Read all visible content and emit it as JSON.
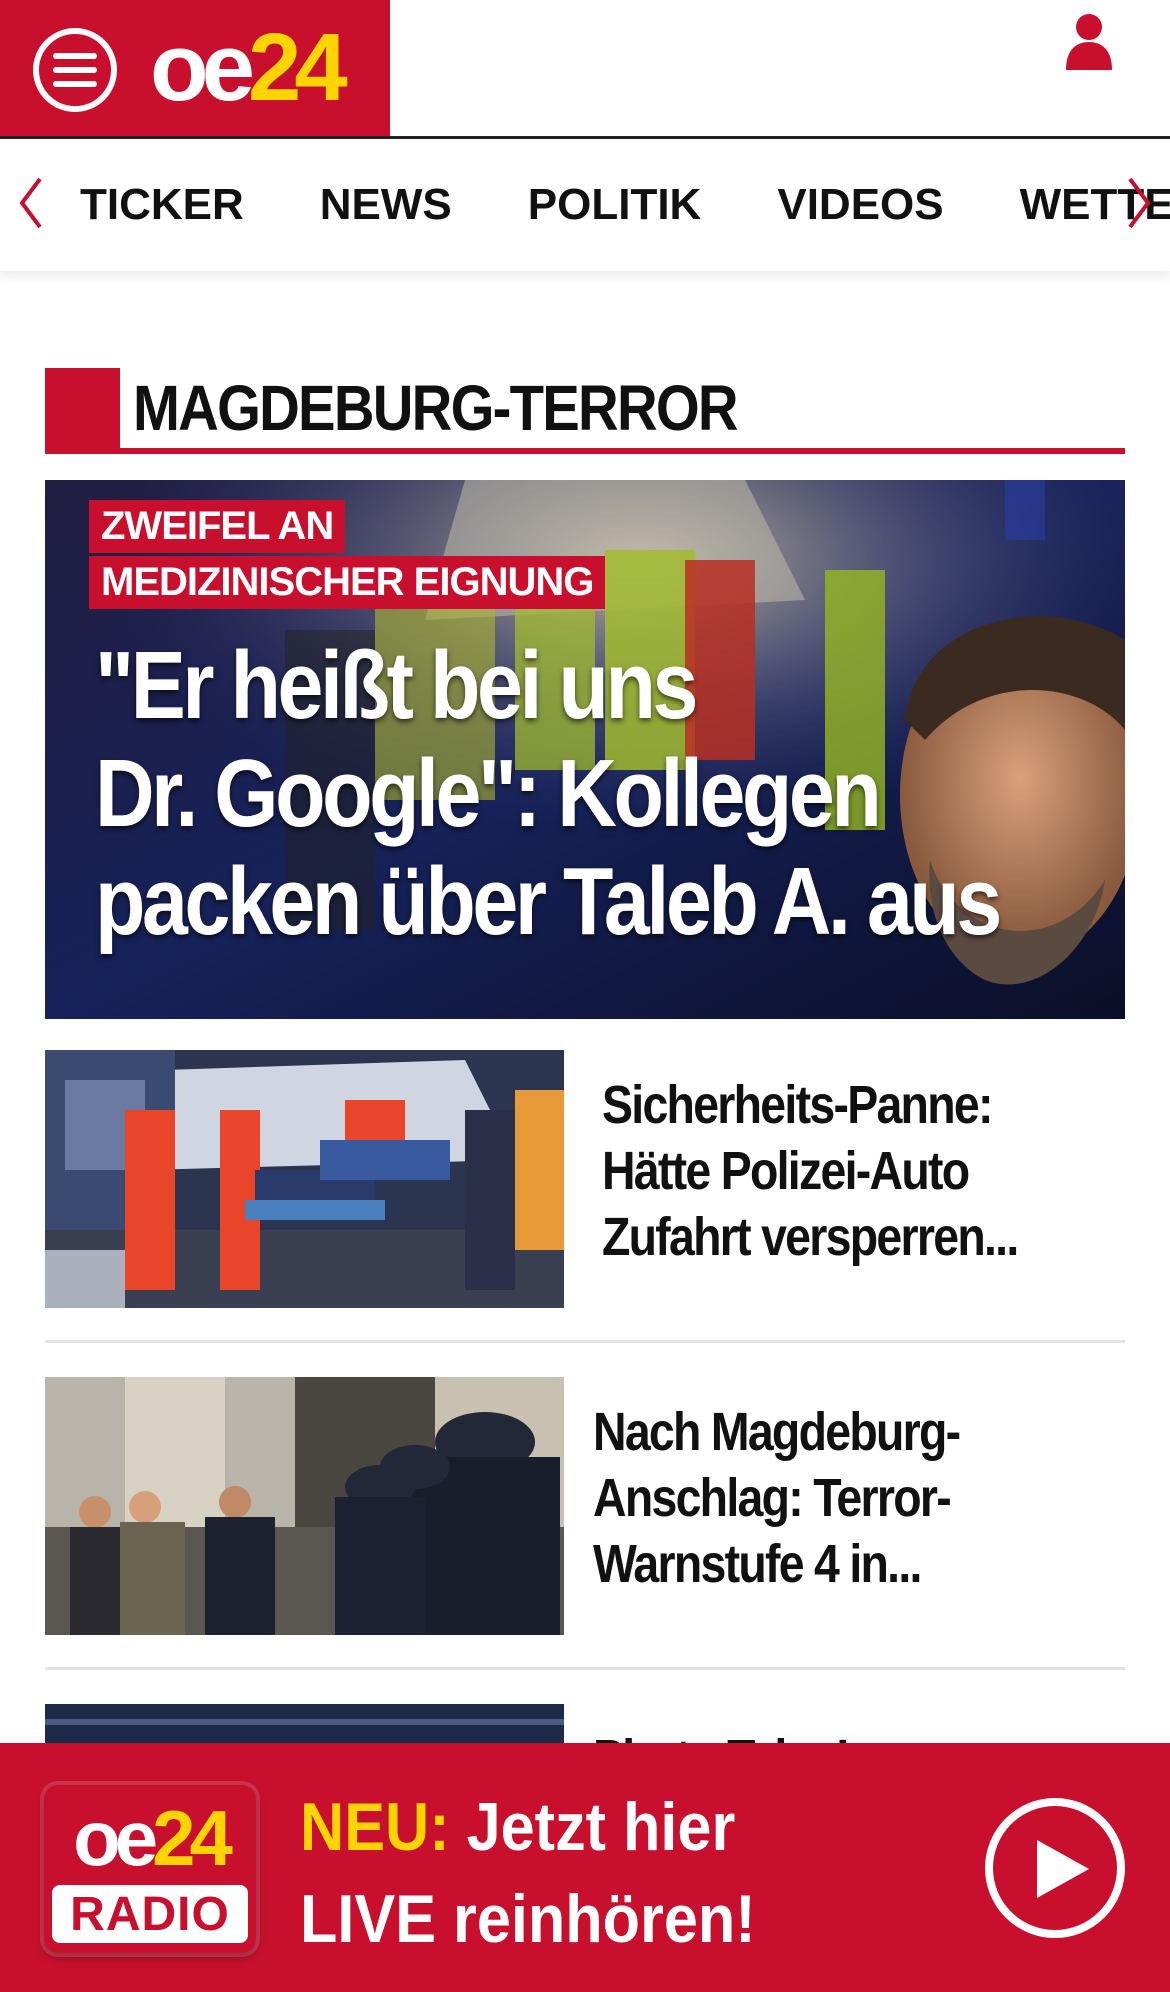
{
  "header": {
    "logo_oe": "oe",
    "logo_num": "24",
    "colors": {
      "brand": "#c8102e",
      "accent": "#ffd400"
    }
  },
  "nav": {
    "items": [
      "TICKER",
      "NEWS",
      "POLITIK",
      "VIDEOS",
      "WETTER"
    ]
  },
  "section": {
    "title": "MAGDEBURG-TERROR"
  },
  "hero": {
    "kicker_line1": "ZWEIFEL AN",
    "kicker_line2": "MEDIZINISCHER EIGNUNG",
    "headline_line1": "\"Er heißt bei uns",
    "headline_line2": "Dr. Google\": Kollegen",
    "headline_line3": "packen über Taleb A. aus"
  },
  "articles": [
    {
      "title_line1": "Sicherheits-Panne:",
      "title_line2": "Hätte Polizei-Auto",
      "title_line3": "Zufahrt versperren..."
    },
    {
      "title_line1": "Nach Magdeburg-",
      "title_line2": "Anschlag: Terror-",
      "title_line3": "Warnstufe 4 in..."
    },
    {
      "title_line1": "Photo Tabe Ina..."
    }
  ],
  "radio": {
    "logo_oe": "oe",
    "logo_num": "24",
    "logo_label": "RADIO",
    "neu_label": "NEU:",
    "line1": "Jetzt hier",
    "line2": "LIVE reinhören!"
  }
}
